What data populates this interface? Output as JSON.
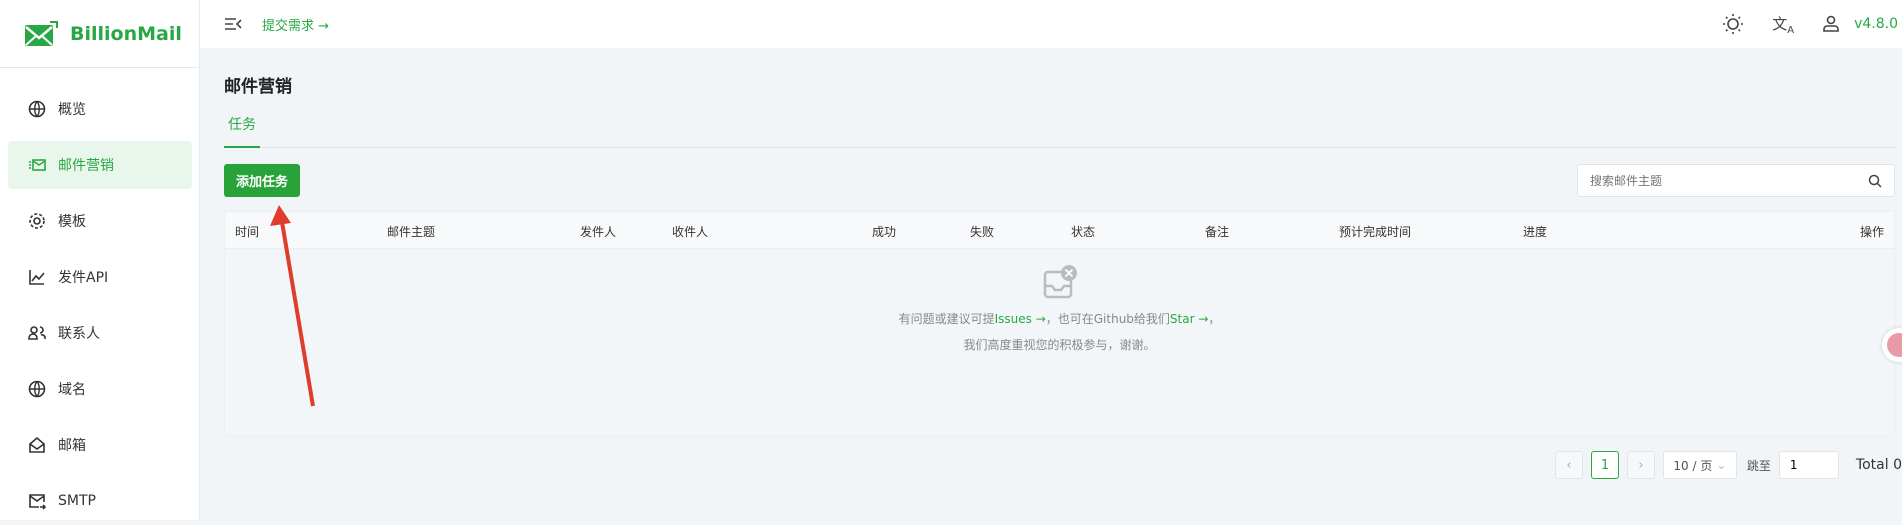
{
  "app": {
    "name": "BillionMail",
    "version": "v4.8.0"
  },
  "topbar": {
    "submit_label": "提交需求 →"
  },
  "sidebar": {
    "items": [
      {
        "label": "概览",
        "icon": "globe-icon"
      },
      {
        "label": "邮件营销",
        "icon": "mail-marketing-icon",
        "active": true
      },
      {
        "label": "模板",
        "icon": "gear-icon"
      },
      {
        "label": "发件API",
        "icon": "chart-line-icon"
      },
      {
        "label": "联系人",
        "icon": "users-icon"
      },
      {
        "label": "域名",
        "icon": "globe-icon"
      },
      {
        "label": "邮箱",
        "icon": "mailbox-icon"
      },
      {
        "label": "SMTP",
        "icon": "mail-send-icon"
      }
    ]
  },
  "page": {
    "title": "邮件营销",
    "tab": "任务",
    "add_button": "添加任务",
    "search_placeholder": "搜索邮件主题"
  },
  "table": {
    "columns": [
      "时间",
      "邮件主题",
      "发件人",
      "收件人",
      "成功",
      "失败",
      "状态",
      "备注",
      "预计完成时间",
      "进度",
      "操作"
    ]
  },
  "empty": {
    "prefix": "有问题或建议可提",
    "issues": "Issues →",
    "middle": "，也可在Github给我们",
    "star": "Star →",
    "suffix": "，",
    "line2": "我们高度重视您的积极参与，谢谢。"
  },
  "pagination": {
    "current": "1",
    "page_size": "10 / 页",
    "jump_label": "跳至",
    "jump_value": "1",
    "total": "Total 0"
  },
  "colors": {
    "accent": "#27a844"
  }
}
